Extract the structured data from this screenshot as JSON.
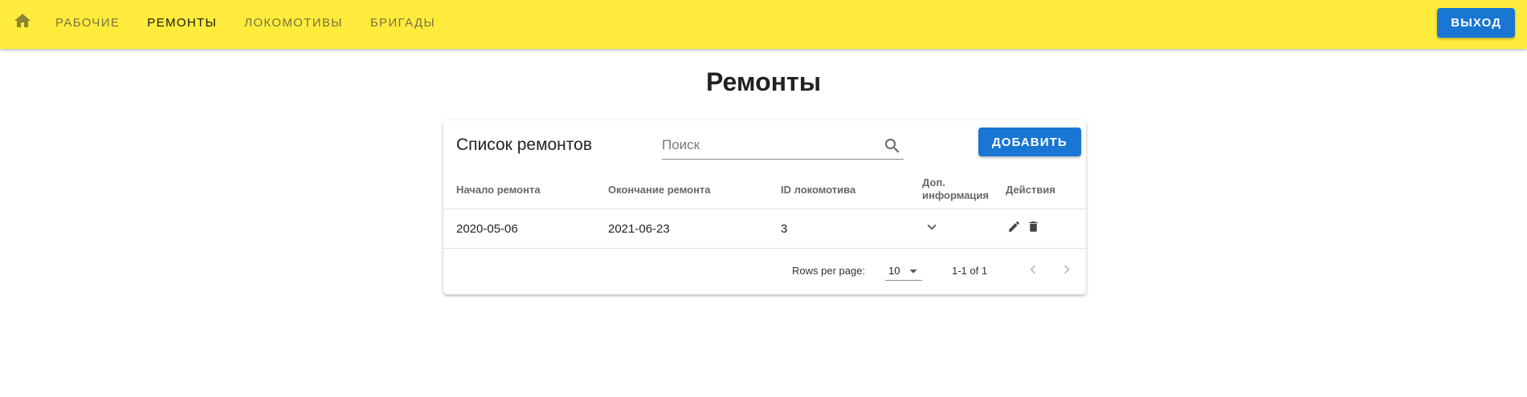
{
  "appbar": {
    "home_icon": "home-icon",
    "nav": [
      {
        "label": "Рабочие",
        "active": false
      },
      {
        "label": "Ремонты",
        "active": true
      },
      {
        "label": "Локомотивы",
        "active": false
      },
      {
        "label": "Бригады",
        "active": false
      }
    ],
    "logout_label": "Выход",
    "background_color": "#ffeb3b",
    "accent_color": "#1976d2"
  },
  "page": {
    "title": "Ремонты"
  },
  "card": {
    "title": "Список ремонтов",
    "search": {
      "placeholder": "Поиск",
      "value": "",
      "icon": "search-icon"
    },
    "add_label": "Добавить"
  },
  "table": {
    "columns": [
      "Начало ремонта",
      "Окончание ремонта",
      "ID локомотива",
      "Доп. информация",
      "Действия"
    ],
    "rows": [
      {
        "start": "2020-05-06",
        "end": "2021-06-23",
        "locomotive_id": "3",
        "expand_icon": "chevron-down-icon",
        "actions": [
          "edit-icon",
          "delete-icon"
        ]
      }
    ]
  },
  "pagination": {
    "rows_per_page_label": "Rows per page:",
    "rows_per_page_value": "10",
    "range_label": "1-1 of 1",
    "prev_icon": "chevron-left-icon",
    "next_icon": "chevron-right-icon"
  }
}
